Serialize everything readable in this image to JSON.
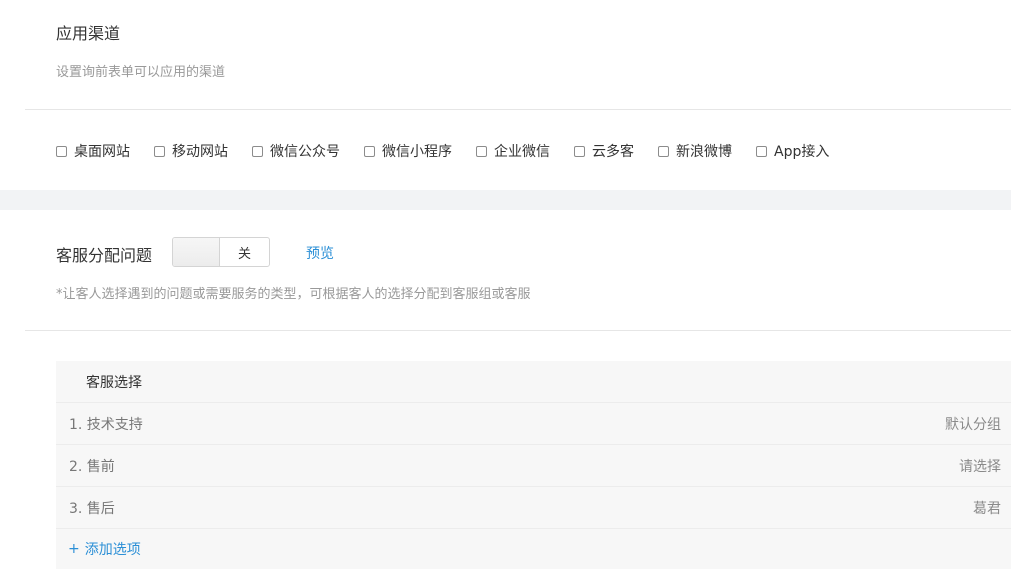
{
  "channels_section": {
    "title": "应用渠道",
    "subtitle": "设置询前表单可以应用的渠道",
    "options": [
      {
        "label": "桌面网站",
        "checked": false
      },
      {
        "label": "移动网站",
        "checked": false
      },
      {
        "label": "微信公众号",
        "checked": false
      },
      {
        "label": "微信小程序",
        "checked": false
      },
      {
        "label": "企业微信",
        "checked": false
      },
      {
        "label": "云多客",
        "checked": false
      },
      {
        "label": "新浪微博",
        "checked": false
      },
      {
        "label": "App接入",
        "checked": false
      }
    ]
  },
  "assign_section": {
    "title": "客服分配问题",
    "toggle_state": "关",
    "preview_link": "预览",
    "hint": "*让客人选择遇到的问题或需要服务的类型，可根据客人的选择分配到客服组或客服"
  },
  "service_table": {
    "header": "客服选择",
    "rows": [
      {
        "label": "1. 技术支持",
        "value": "默认分组"
      },
      {
        "label": "2. 售前",
        "value": "请选择"
      },
      {
        "label": "3. 售后",
        "value": "葛君"
      }
    ],
    "add_plus": "+",
    "add_label": "添加选项"
  }
}
